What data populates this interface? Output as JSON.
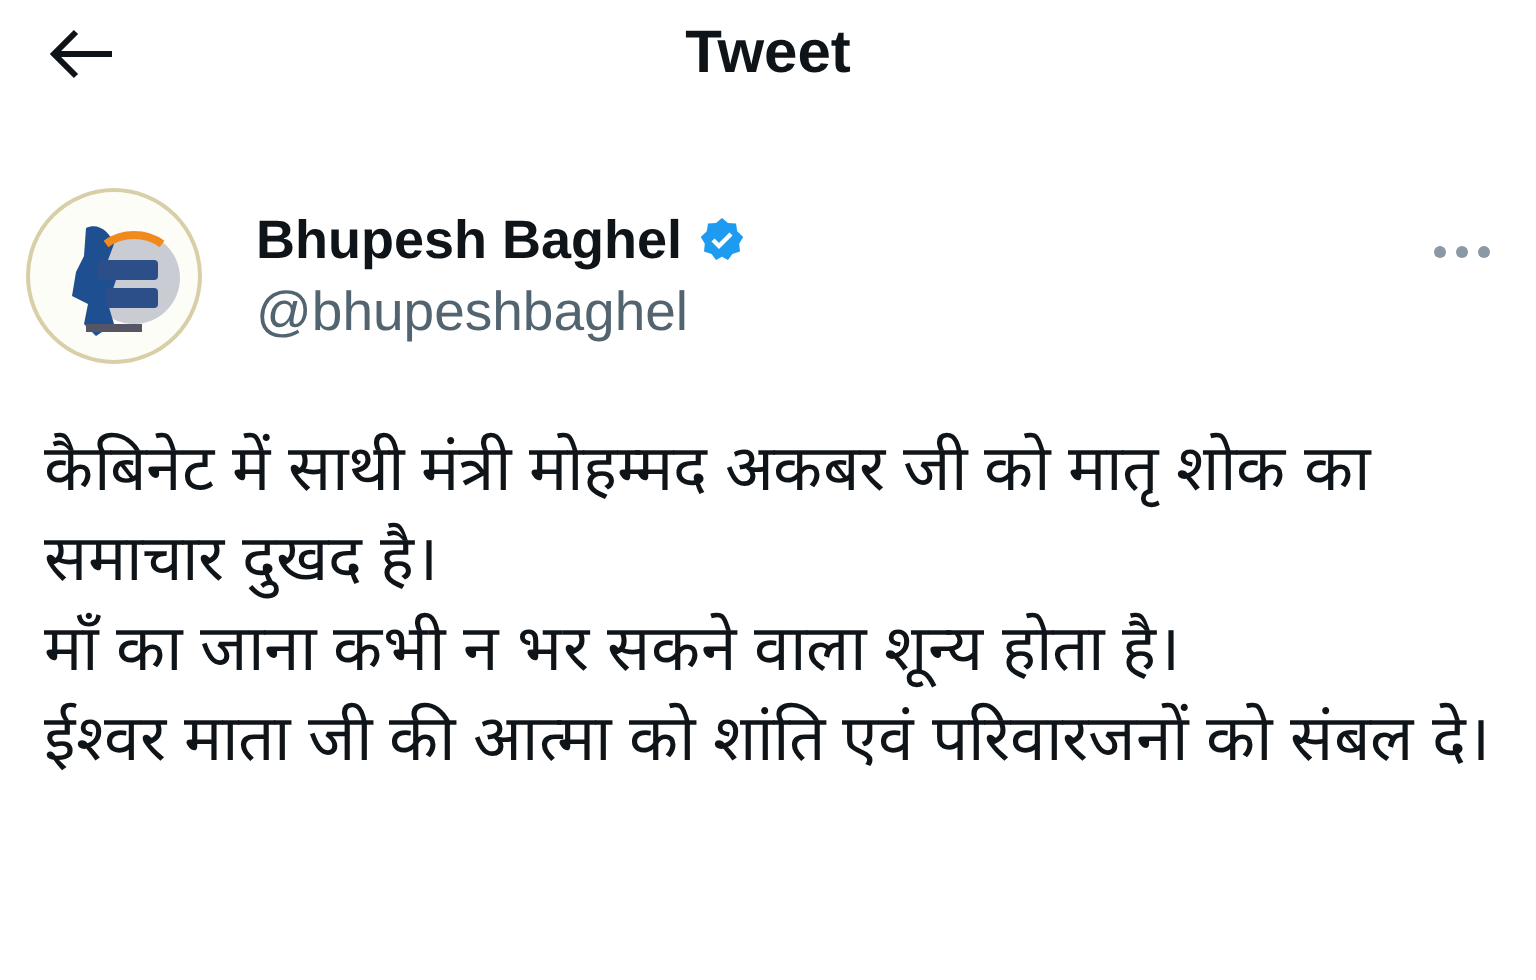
{
  "header": {
    "title": "Tweet"
  },
  "author": {
    "name": "Bhupesh Baghel",
    "verified": true,
    "handle": "@bhupeshbaghel"
  },
  "tweet": {
    "lines": [
      "कैबिनेट में साथी मंत्री मोहम्मद अकबर जी को मातृ शोक का समाचार दुखद है।",
      "माँ का जाना कभी न भर सकने वाला शून्य होता है।",
      "ईश्वर माता जी की आत्मा को शांति एवं परिवारजनों को संबल दे।"
    ]
  }
}
